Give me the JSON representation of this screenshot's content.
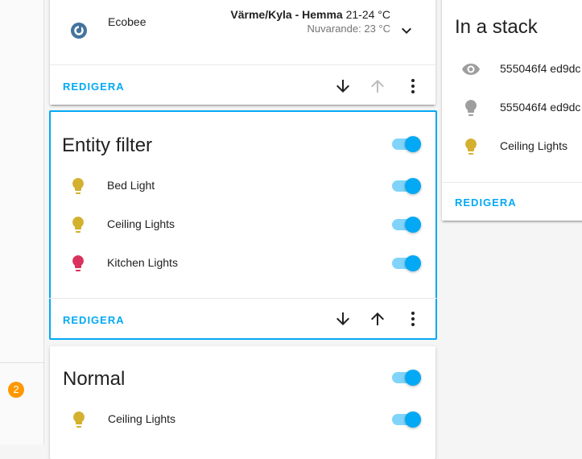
{
  "sidebar": {
    "badge_count": "2"
  },
  "thermostat_card": {
    "entity_name": "Ecobee",
    "mode": "Värme/Kyla - Hemma",
    "target": "21-24 °C",
    "current": "Nuvarande: 23 °C",
    "edit_label": "REDIGERA"
  },
  "entity_filter_card": {
    "title": "Entity filter",
    "edit_label": "REDIGERA",
    "header_toggle_on": true,
    "entities": [
      {
        "name": "Bed Light",
        "icon": "lightbulb-icon",
        "color": "#d4b02f",
        "on": true
      },
      {
        "name": "Ceiling Lights",
        "icon": "lightbulb-icon",
        "color": "#d4b02f",
        "on": true
      },
      {
        "name": "Kitchen Lights",
        "icon": "lightbulb-icon",
        "color": "#d9325c",
        "on": true
      }
    ]
  },
  "normal_card": {
    "title": "Normal",
    "entities": [
      {
        "name": "Ceiling Lights",
        "icon": "lightbulb-icon",
        "color": "#d4b02f",
        "on": true
      }
    ]
  },
  "stack_card": {
    "title": "In a stack",
    "edit_label": "REDIGERA",
    "entities": [
      {
        "name": "555046f4 ed9dc",
        "icon": "eye-icon",
        "color": "#9e9e9e"
      },
      {
        "name": "555046f4 ed9dc",
        "icon": "lightbulb-icon",
        "color": "#9e9e9e"
      },
      {
        "name": "Ceiling Lights",
        "icon": "lightbulb-icon",
        "color": "#d4b02f"
      }
    ]
  },
  "colors": {
    "accent": "#03a9f4",
    "badge": "#ff9800",
    "bulb_on": "#d4b02f",
    "bulb_red": "#d9325c",
    "inactive": "#9e9e9e"
  }
}
